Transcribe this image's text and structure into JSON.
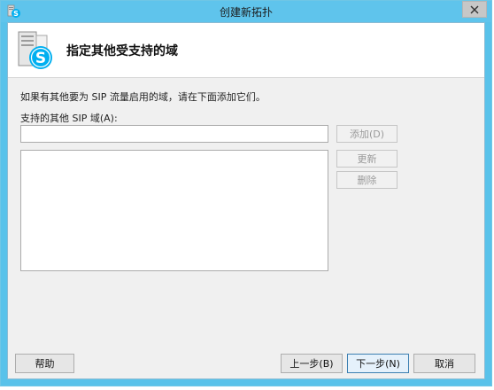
{
  "window": {
    "title": "创建新拓扑",
    "close_symbol": "✕"
  },
  "header": {
    "title": "指定其他受支持的域"
  },
  "content": {
    "instruction": "如果有其他要为 SIP 流量启用的域，请在下面添加它们。",
    "field_label": "支持的其他 SIP 域(A):",
    "sip_input_value": "",
    "domains": []
  },
  "side_buttons": {
    "add": "添加(D)",
    "update": "更新",
    "delete": "删除"
  },
  "bottom_buttons": {
    "help": "帮助",
    "back": "上一步(B)",
    "next": "下一步(N)",
    "cancel": "取消"
  },
  "colors": {
    "titlebar": "#5fc4ec",
    "skype_blue": "#00aff0"
  },
  "icons": {
    "app": "skype-server-icon",
    "header": "skype-server-icon",
    "close": "close-icon"
  }
}
